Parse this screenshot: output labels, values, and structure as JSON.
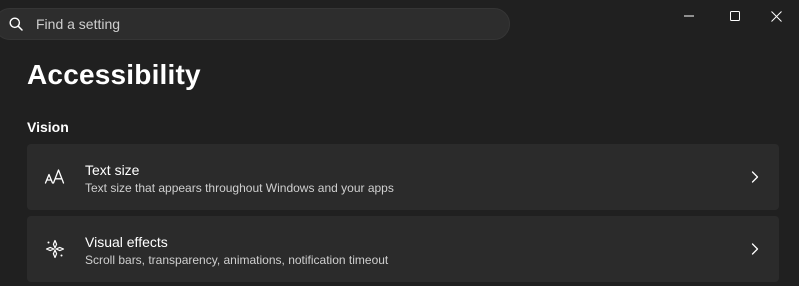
{
  "search": {
    "placeholder": "Find a setting"
  },
  "window_controls": [
    "minimize",
    "maximize",
    "close"
  ],
  "header": {
    "title": "Accessibility"
  },
  "sections": [
    {
      "title": "Vision",
      "items": [
        {
          "icon": "text-size-icon",
          "title": "Text size",
          "description": "Text size that appears throughout Windows and your apps"
        },
        {
          "icon": "visual-effects-icon",
          "title": "Visual effects",
          "description": "Scroll bars, transparency, animations, notification timeout"
        }
      ]
    }
  ],
  "colors": {
    "background": "#202020",
    "card": "#2b2b2b",
    "search_box": "#2d2d2d",
    "text_primary": "#ffffff",
    "text_secondary": "#cfcfcf"
  }
}
